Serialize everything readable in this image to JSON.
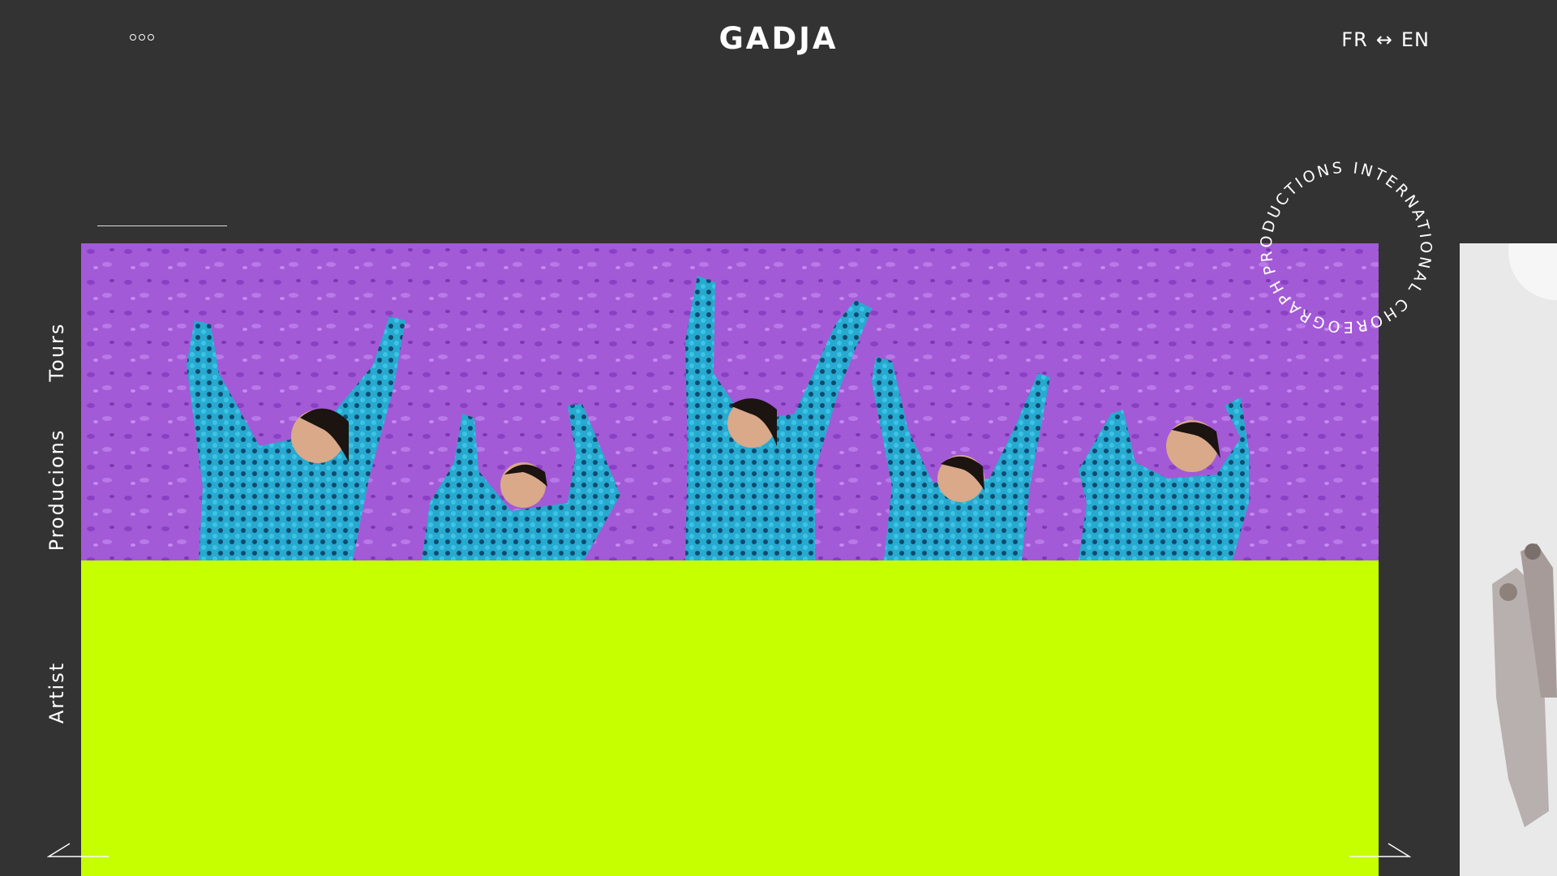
{
  "header": {
    "brand": "GADJA",
    "lang_from": "FR",
    "lang_swap": "↔",
    "lang_to": "EN"
  },
  "nav": {
    "tours": "Tours",
    "productions": "Producions",
    "artist": "Artist"
  },
  "badge": {
    "circle_text": "PRODUCTIONS INTERNATIONAL CHOREOGRAPHER "
  },
  "colors": {
    "background": "#333333",
    "hero_band": "#c6ff00",
    "hero_wall": "#a35ad6",
    "costume": "#1fa3c8"
  },
  "icons": {
    "menu": "menu-dots-icon",
    "prev": "arrow-left-icon",
    "next": "arrow-right-icon"
  }
}
